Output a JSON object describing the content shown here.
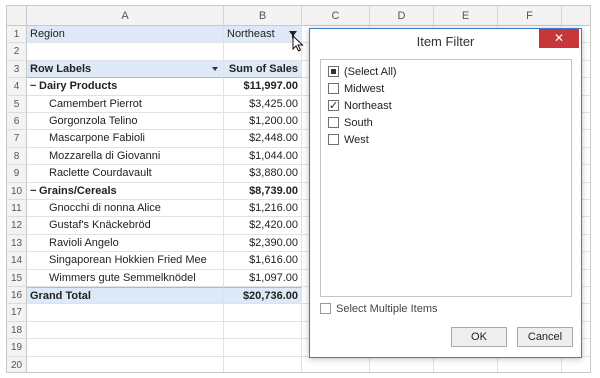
{
  "columns": [
    "A",
    "B",
    "C",
    "D",
    "E",
    "F"
  ],
  "row_numbers": [
    "1",
    "2",
    "3",
    "4",
    "5",
    "6",
    "7",
    "8",
    "9",
    "10",
    "11",
    "12",
    "13",
    "14",
    "15",
    "16",
    "17",
    "18",
    "19",
    "20"
  ],
  "rows": [
    {
      "a": "Region",
      "b": "Northeast"
    },
    {
      "a": "",
      "b": ""
    },
    {
      "a": "Row Labels",
      "b": "Sum of Sales"
    },
    {
      "a": "Dairy Products",
      "b": "$11,997.00"
    },
    {
      "a": "Camembert Pierrot",
      "b": "$3,425.00"
    },
    {
      "a": "Gorgonzola Telino",
      "b": "$1,200.00"
    },
    {
      "a": "Mascarpone Fabioli",
      "b": "$2,448.00"
    },
    {
      "a": "Mozzarella di Giovanni",
      "b": "$1,044.00"
    },
    {
      "a": "Raclette Courdavault",
      "b": "$3,880.00"
    },
    {
      "a": "Grains/Cereals",
      "b": "$8,739.00"
    },
    {
      "a": "Gnocchi di nonna Alice",
      "b": "$1,216.00"
    },
    {
      "a": "Gustaf's Knäckebröd",
      "b": "$2,420.00"
    },
    {
      "a": "Ravioli Angelo",
      "b": "$2,390.00"
    },
    {
      "a": "Singaporean Hokkien Fried Mee",
      "b": "$1,616.00"
    },
    {
      "a": "Wimmers gute Semmelknödel",
      "b": "$1,097.00"
    },
    {
      "a": "Grand Total",
      "b": "$20,736.00"
    }
  ],
  "collapse_glyph": "−",
  "dialog": {
    "title": "Item Filter",
    "close_glyph": "✕",
    "items": [
      {
        "label": "(Select All)",
        "state": "partial"
      },
      {
        "label": "Midwest",
        "state": "unchecked"
      },
      {
        "label": "Northeast",
        "state": "checked"
      },
      {
        "label": "South",
        "state": "unchecked"
      },
      {
        "label": "West",
        "state": "unchecked"
      }
    ],
    "multi_label": "Select Multiple Items",
    "ok_label": "OK",
    "cancel_label": "Cancel"
  },
  "colors": {
    "header_highlight": "#dde9f6",
    "dialog_border": "#3c7bd1",
    "close_button": "#c7373a"
  }
}
